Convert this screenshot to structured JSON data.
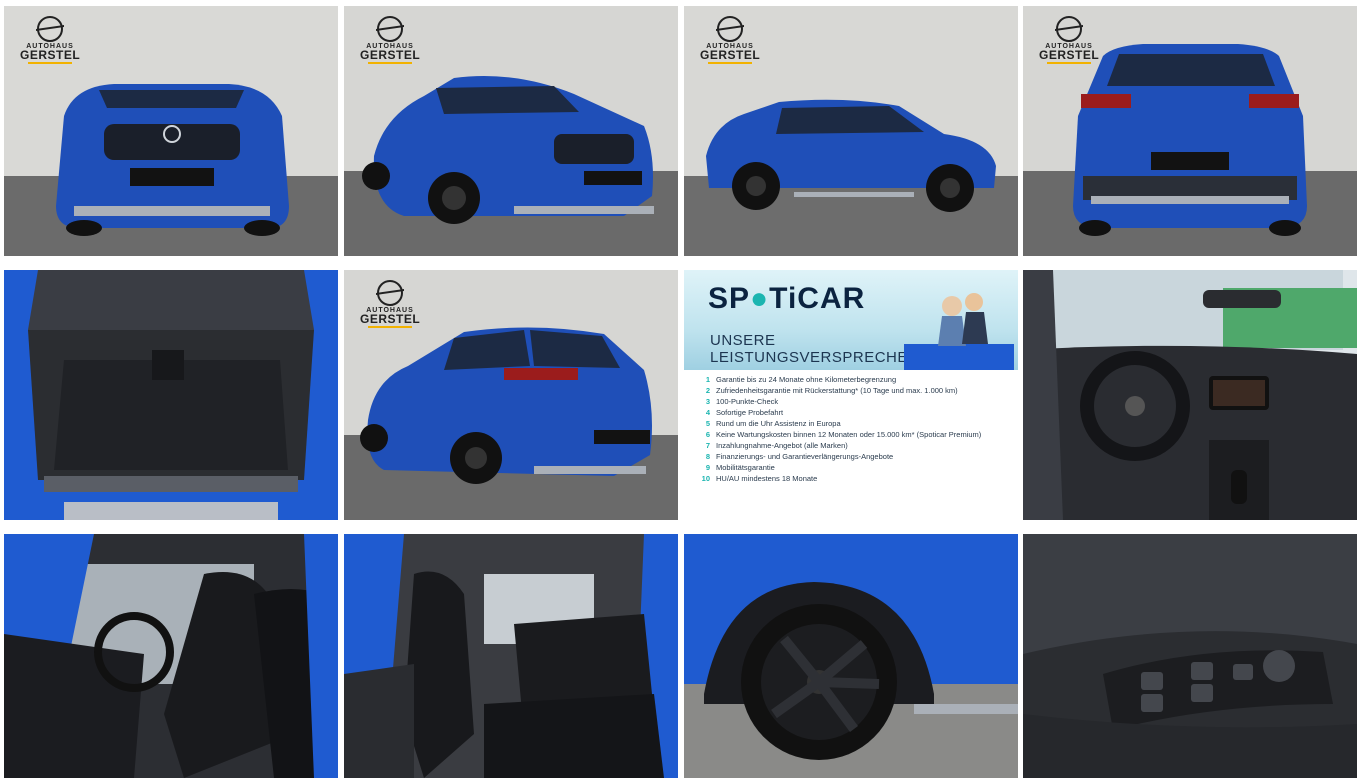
{
  "gallery": {
    "tiles": [
      {
        "alt": "front"
      },
      {
        "alt": "front-right"
      },
      {
        "alt": "side"
      },
      {
        "alt": "rear"
      },
      {
        "alt": "trunk"
      },
      {
        "alt": "rear-three-quarter"
      },
      {
        "alt": "spoticar-promo"
      },
      {
        "alt": "cockpit"
      },
      {
        "alt": "front-seats"
      },
      {
        "alt": "rear-seats"
      },
      {
        "alt": "wheel"
      },
      {
        "alt": "door-controls"
      }
    ]
  },
  "dealer_logo": {
    "top": "AUTOHAUS",
    "name": "GERSTEL"
  },
  "plate": {
    "text": "SPOTICAR"
  },
  "promo": {
    "brand_a": "SP",
    "brand_b": "TiCAR",
    "heading_1": "UNSERE",
    "heading_2": "LEISTUNGSVERSPRECHEN",
    "items": [
      {
        "n": "1",
        "text": "Garantie bis zu 24 Monate ohne Kilometerbegrenzung"
      },
      {
        "n": "2",
        "text": "Zufriedenheitsgarantie mit Rückerstattung* (10 Tage und max. 1.000 km)"
      },
      {
        "n": "3",
        "text": "100-Punkte-Check"
      },
      {
        "n": "4",
        "text": "Sofortige Probefahrt"
      },
      {
        "n": "5",
        "text": "Rund um die Uhr Assistenz in Europa"
      },
      {
        "n": "6",
        "text": "Keine Wartungskosten binnen 12 Monaten oder 15.000 km* (Spoticar Premium)"
      },
      {
        "n": "7",
        "text": "Inzahlungnahme-Angebot (alle Marken)"
      },
      {
        "n": "8",
        "text": "Finanzierungs- und Garantieverlängerungs-Angebote"
      },
      {
        "n": "9",
        "text": "Mobilitätsgarantie"
      },
      {
        "n": "10",
        "text": "HU/AU mindestens 18 Monate"
      }
    ]
  },
  "colors": {
    "car_blue": "#1f4fb8",
    "wall": "#d8d8d6",
    "floor": "#6e6e6e",
    "accent": "#1bb5b0"
  }
}
